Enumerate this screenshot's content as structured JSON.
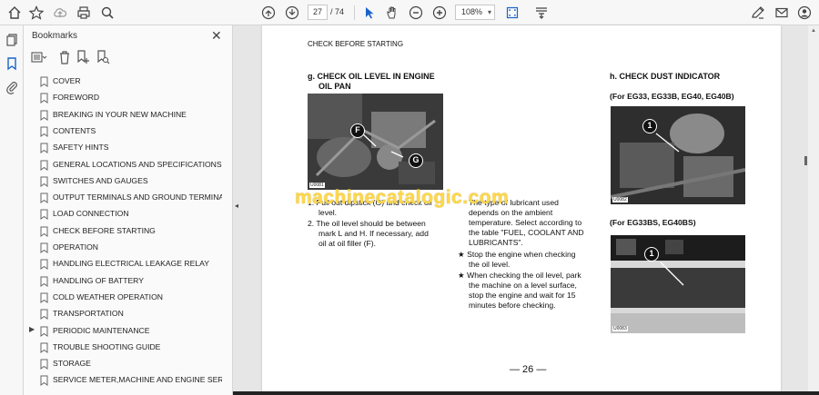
{
  "toolbar": {
    "page_current": "27",
    "page_total": "/  74",
    "zoom": "108%",
    "icons": [
      "home-icon",
      "bookmark-star-icon",
      "upload-icon",
      "print-icon",
      "zoom-search-icon",
      "page-up-icon",
      "page-down-icon",
      "select-pointer-icon",
      "hand-icon",
      "zoom-out-icon",
      "zoom-in-icon",
      "fit-page-icon",
      "scroll-mode-icon",
      "sign-pen-icon",
      "mail-icon",
      "account-icon"
    ]
  },
  "rail": {
    "icons": [
      "pages-icon",
      "bookmarks-icon",
      "attachments-icon"
    ]
  },
  "bookmarks_panel": {
    "title": "Bookmarks",
    "close_label": "✕",
    "tools": [
      "options-menu-icon",
      "delete-bookmark-icon",
      "add-bookmark-icon",
      "find-bookmark-icon"
    ],
    "items": [
      {
        "label": "COVER",
        "expandable": false
      },
      {
        "label": "FOREWORD",
        "expandable": false
      },
      {
        "label": "BREAKING IN YOUR NEW MACHINE",
        "expandable": false
      },
      {
        "label": "CONTENTS",
        "expandable": false
      },
      {
        "label": "SAFETY HINTS",
        "expandable": false
      },
      {
        "label": "GENERAL LOCATIONS AND SPECIFICATIONS",
        "expandable": false
      },
      {
        "label": "SWITCHES AND GAUGES",
        "expandable": false
      },
      {
        "label": "OUTPUT TERMINALS AND GROUND TERMINAL",
        "expandable": false
      },
      {
        "label": "LOAD CONNECTION",
        "expandable": false
      },
      {
        "label": "CHECK BEFORE STARTING",
        "expandable": false
      },
      {
        "label": "OPERATION",
        "expandable": false
      },
      {
        "label": "HANDLING ELECTRICAL LEAKAGE RELAY",
        "expandable": false
      },
      {
        "label": "HANDLING OF BATTERY",
        "expandable": false
      },
      {
        "label": "COLD WEATHER OPERATION",
        "expandable": false
      },
      {
        "label": "TRANSPORTATION",
        "expandable": false
      },
      {
        "label": "PERIODIC MAINTENANCE",
        "expandable": true
      },
      {
        "label": "TROUBLE SHOOTING GUIDE",
        "expandable": false
      },
      {
        "label": "STORAGE",
        "expandable": false
      },
      {
        "label": "SERVICE METER,MACHINE AND ENGINE SERIAL NUMBERS",
        "expandable": false
      }
    ]
  },
  "page": {
    "header": "CHECK BEFORE STARTING",
    "section_g": {
      "title_line1": "g.  CHECK OIL LEVEL IN ENGINE",
      "title_line2": "OIL PAN",
      "callout_f": "F",
      "callout_g": "G",
      "photo_code": "U0081",
      "step1_line1": "1.  Pull out dipstick (G) and check oil",
      "step1_line2": "level.",
      "step2_line1": "2.  The oil level should be between",
      "step2_line2": "mark L and H. If necessary, add",
      "step2_line3": "oil at oil filler (F)."
    },
    "middle": {
      "line1": "The type of lubricant used",
      "line2": "depends on the ambient",
      "line3": "temperature. Select according to",
      "line4": "the table \"FUEL, COOLANT AND",
      "line5": "LUBRICANTS\".",
      "star1_line1": "★  Stop the engine when checking",
      "star1_line2": "the oil level.",
      "star2_line1": "★  When checking the oil level, park",
      "star2_line2": "the machine on a level surface,",
      "star2_line3": "stop the engine and wait for 15",
      "star2_line4": "minutes before checking."
    },
    "section_h": {
      "title": "h.  CHECK DUST INDICATOR",
      "sub1": "(For EG33, EG33B, EG40, EG40B)",
      "callout_1": "1",
      "photo1_code": "U0082",
      "sub2": "(For EG33BS, EG40BS)",
      "callout_2": "1",
      "photo2_code": "U0083"
    },
    "watermark": "machinecatalogic.com",
    "page_number": "— 26 —"
  }
}
